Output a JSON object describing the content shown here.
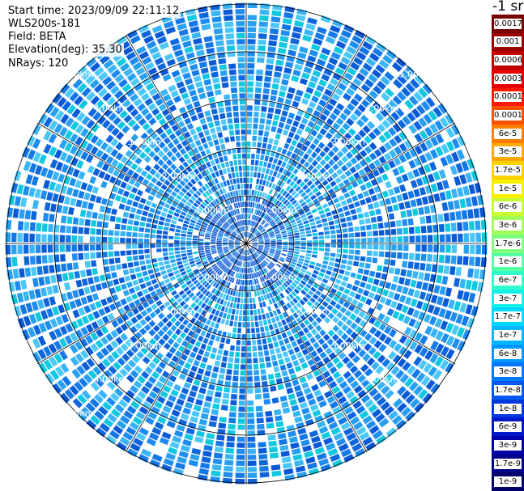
{
  "info": {
    "start_time": "Start time: 2023/09/09 22:11:12",
    "device": "WLS200s-181",
    "field": "Field: BETA",
    "elevation": "Elevation(deg): 35.30",
    "nrays": "NRays: 120"
  },
  "colorbar": {
    "unit": "-1 sr",
    "segments": [
      {
        "label": "0.0017",
        "color": "#7a0000"
      },
      {
        "label": "0.001",
        "color": "#9a0000"
      },
      {
        "label": "0.0006",
        "color": "#c00000"
      },
      {
        "label": "0.0003",
        "color": "#e40000"
      },
      {
        "label": "0.00017",
        "color": "#ff1a00"
      },
      {
        "label": "0.0001",
        "color": "#ff5000"
      },
      {
        "label": "6e-5",
        "color": "#ff7c00"
      },
      {
        "label": "3e-5",
        "color": "#ffa800"
      },
      {
        "label": "1.7e-5",
        "color": "#ffd000"
      },
      {
        "label": "1e-5",
        "color": "#f7f000"
      },
      {
        "label": "6e-6",
        "color": "#c8ff30"
      },
      {
        "label": "3e-6",
        "color": "#a0ff5a"
      },
      {
        "label": "1.7e-6",
        "color": "#7cff7c"
      },
      {
        "label": "1e-6",
        "color": "#55ffa4"
      },
      {
        "label": "6e-7",
        "color": "#2effcc"
      },
      {
        "label": "3e-7",
        "color": "#14f0e8"
      },
      {
        "label": "1.7e-7",
        "color": "#00d8ff"
      },
      {
        "label": "1e-7",
        "color": "#00b8ff"
      },
      {
        "label": "6e-8",
        "color": "#0098ff"
      },
      {
        "label": "3e-8",
        "color": "#0078ff"
      },
      {
        "label": "1.7e-8",
        "color": "#0058f4"
      },
      {
        "label": "1e-8",
        "color": "#0038e0"
      },
      {
        "label": "6e-9",
        "color": "#0018c8"
      },
      {
        "label": "3e-9",
        "color": "#0000a8"
      },
      {
        "label": "1.7e-9",
        "color": "#000088"
      },
      {
        "label": "1e-9",
        "color": "#00006a"
      }
    ]
  },
  "range_labels": [
    "1.00km",
    "2.00km",
    "3.00km",
    "4.00km",
    "5.00km"
  ],
  "palette": {
    "field": [
      "#0a5ad8",
      "#1478e6",
      "#1e8cf0",
      "#28a0f0",
      "#3ab4f5",
      "#4cc8f8",
      "#12c8e0",
      "#0e66dd"
    ],
    "gap": "#ffffff",
    "near": "#1f62d8"
  }
}
